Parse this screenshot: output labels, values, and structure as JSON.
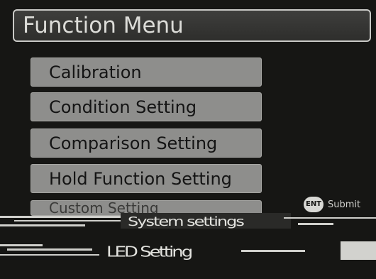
{
  "header": {
    "title": "Function Menu"
  },
  "menu": {
    "items": [
      {
        "label": "Calibration"
      },
      {
        "label": "Condition Setting"
      },
      {
        "label": "Comparison Setting"
      },
      {
        "label": "Hold Function Setting"
      },
      {
        "label": "Custom Setting"
      }
    ]
  },
  "hint": {
    "key": "ENT",
    "action": "Submit"
  },
  "glitch": {
    "line1": "System settings",
    "line2": "LED Setting"
  },
  "colors": {
    "background": "#161614",
    "menu_item_bg": "#8e8e8c",
    "title_border": "#c9c9c6",
    "text_dark": "#141414",
    "text_light": "#dcdcd8"
  }
}
